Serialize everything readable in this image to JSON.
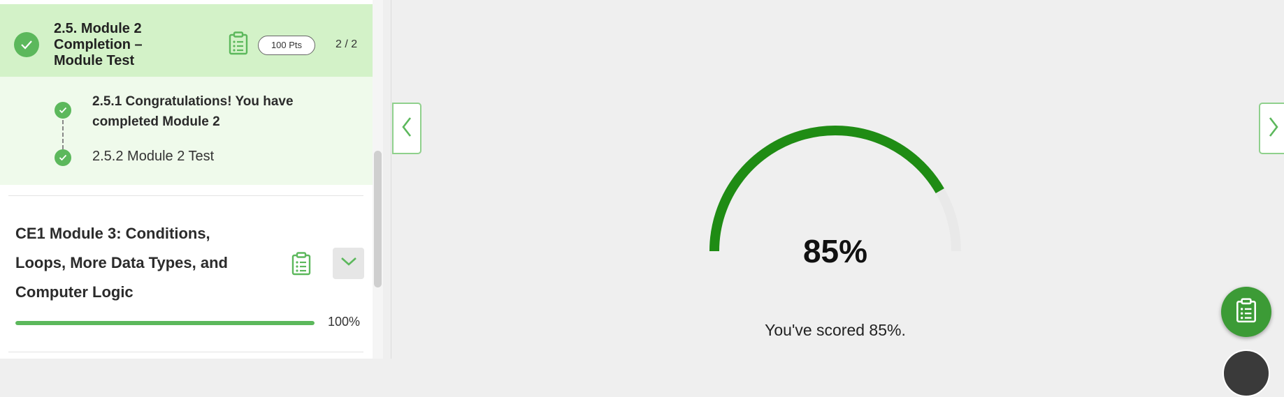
{
  "sidebar": {
    "module2": {
      "title": "2.5. Module 2 Completion – Module Test",
      "icon": "clipboard-icon",
      "points": "100 Pts",
      "count": "2 / 2",
      "items": [
        {
          "label": "2.5.1 Congratulations! You have completed Module 2",
          "status": "complete"
        },
        {
          "label": "2.5.2 Module 2 Test",
          "status": "complete"
        }
      ]
    },
    "module3": {
      "title": "CE1 Module 3: Conditions, Loops, More Data Types, and Computer Logic",
      "icon": "clipboard-icon",
      "expand_icon": "chevron-down-icon",
      "progress": 100,
      "progress_label": "100%"
    }
  },
  "main": {
    "score": {
      "percent": 85,
      "label": "85%",
      "message": "You've scored 85%."
    },
    "nav": {
      "prev_icon": "chevron-left-icon",
      "next_icon": "chevron-right-icon"
    },
    "fab_icon": "clipboard-icon"
  },
  "colors": {
    "accent": "#5cb85c",
    "gauge": "#1f8c14",
    "header_bg": "#d3f2c8",
    "sub_bg": "#effaeb"
  }
}
